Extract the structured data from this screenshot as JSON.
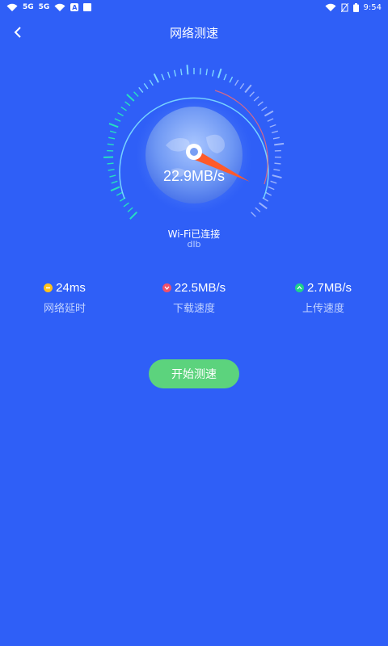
{
  "status_bar": {
    "signal1": "5G",
    "signal2": "5G",
    "app_letter": "A",
    "time": "9:54"
  },
  "header": {
    "title": "网络测速"
  },
  "gauge": {
    "speed": "22.9MB/s"
  },
  "connection": {
    "status": "Wi-Fi已连接",
    "name": "dlb"
  },
  "stats": [
    {
      "value": "24ms",
      "label": "网络延时",
      "color": "#ffc21a",
      "icon": "latency-icon"
    },
    {
      "value": "22.5MB/s",
      "label": "下载速度",
      "color": "#f0506a",
      "icon": "download-icon"
    },
    {
      "value": "2.7MB/s",
      "label": "上传速度",
      "color": "#1fd28a",
      "icon": "upload-icon"
    }
  ],
  "start_button": {
    "label": "开始测速"
  },
  "colors": {
    "background": "#2f5ff7",
    "button": "#5cd37d",
    "needle": "#ff5a2a"
  }
}
